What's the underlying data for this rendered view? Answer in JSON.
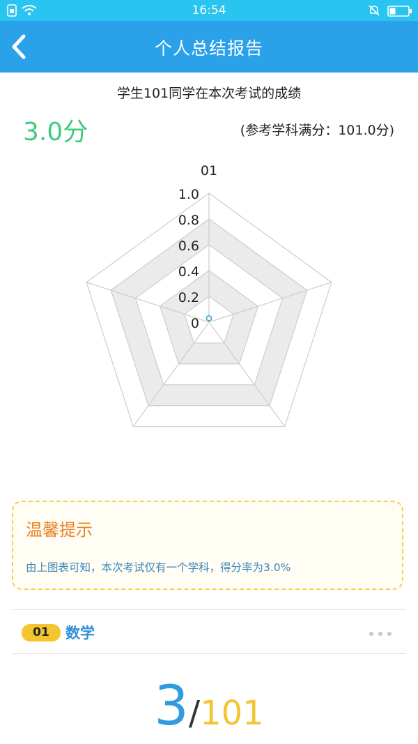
{
  "status_bar": {
    "time": "16:54"
  },
  "header": {
    "title": "个人总结报告"
  },
  "report": {
    "subtitle": "学生101同学在本次考试的成绩",
    "score": "3.0分",
    "full_mark": "(参考学科满分：101.0分)"
  },
  "chart_data": {
    "type": "radar",
    "axes": [
      "01"
    ],
    "ticks": [
      "0",
      "0.2",
      "0.4",
      "0.6",
      "0.8",
      "1.0"
    ],
    "range": [
      0,
      1.0
    ],
    "series": [
      {
        "values": [
          0.03
        ]
      }
    ]
  },
  "tip": {
    "title": "温馨提示",
    "text": "由上图表可知，本次考试仅有一个学科，得分率为3.0%"
  },
  "subject": {
    "index": "01",
    "name": "数学"
  },
  "subject_score": {
    "score": "3",
    "separator": "/",
    "total": "101"
  },
  "colors": {
    "status_bar": "#29c4f0",
    "header": "#2aa1e8",
    "score_green": "#3ecb7e",
    "tip_border": "#f5d043",
    "tip_title": "#e8852a",
    "badge": "#f5c530",
    "subject_blue": "#2f8fd8"
  }
}
